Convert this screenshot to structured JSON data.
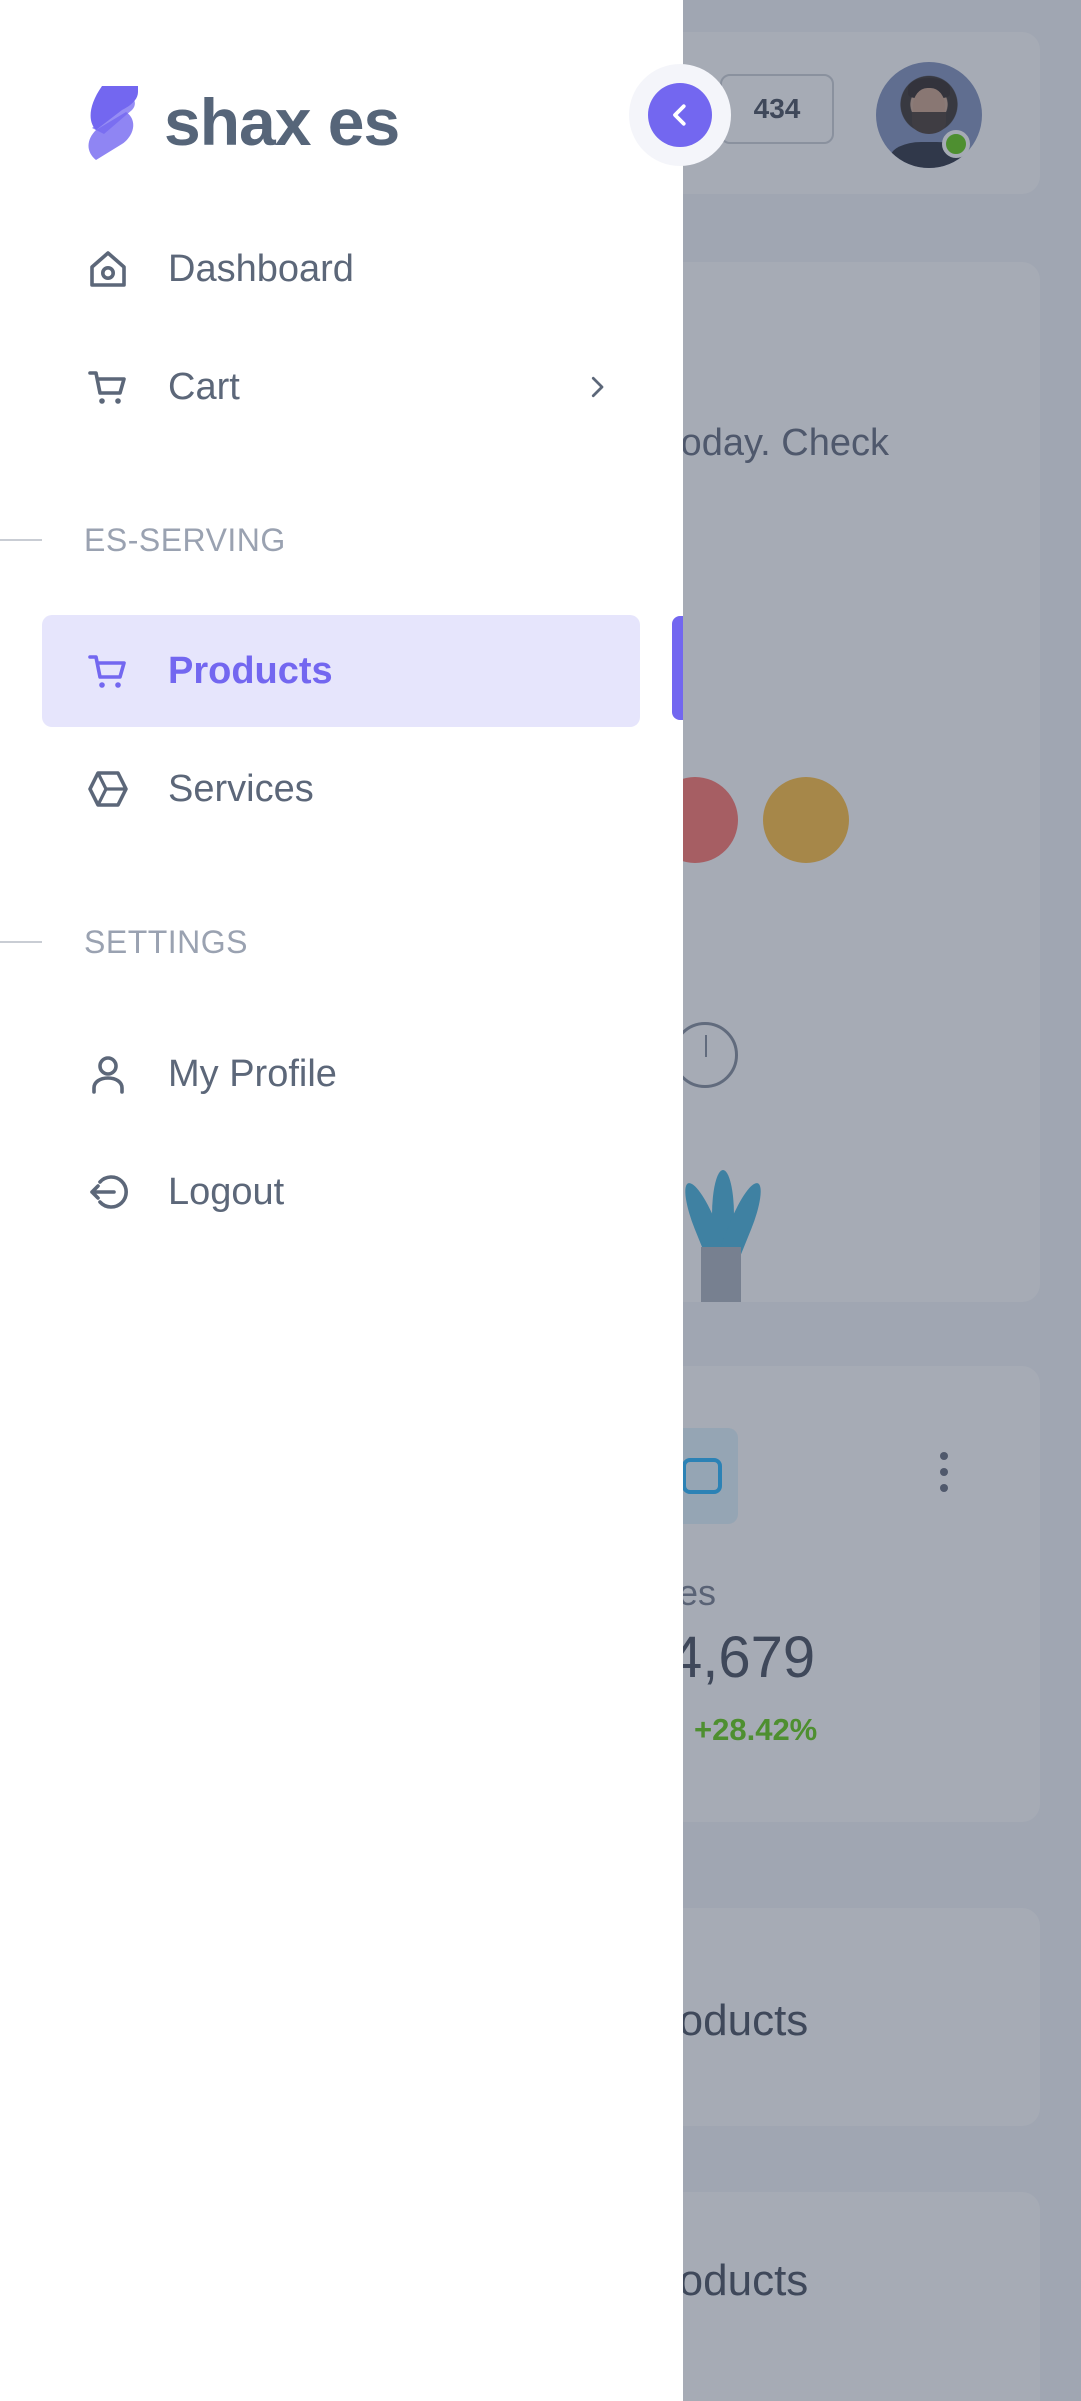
{
  "app": {
    "name": "shax es",
    "accent_color": "#7367f0"
  },
  "drawer": {
    "collapse_icon": "chevron-left-icon",
    "items": [
      {
        "label": "Dashboard",
        "icon": "home-icon",
        "active": false
      },
      {
        "label": "Cart",
        "icon": "cart-icon",
        "active": false,
        "has_submenu": true
      }
    ],
    "sections": [
      {
        "title": "ES-SERVING",
        "items": [
          {
            "label": "Products",
            "icon": "cart-icon",
            "active": true
          },
          {
            "label": "Services",
            "icon": "hexagon-icon",
            "active": false
          }
        ]
      },
      {
        "title": "SETTINGS",
        "items": [
          {
            "label": "My Profile",
            "icon": "user-icon",
            "active": false
          },
          {
            "label": "Logout",
            "icon": "logout-icon",
            "active": false
          }
        ]
      }
    ]
  },
  "background": {
    "topbar": {
      "counter": "434",
      "avatar_status_color": "#56ca00"
    },
    "welcome_card": {
      "text": "today. Check"
    },
    "sales_card": {
      "label": "les",
      "value": "4,679",
      "delta": "+28.42%",
      "delta_color": "#56ca00"
    },
    "products_cards": [
      {
        "title": "roducts"
      },
      {
        "title": "roducts"
      }
    ]
  }
}
